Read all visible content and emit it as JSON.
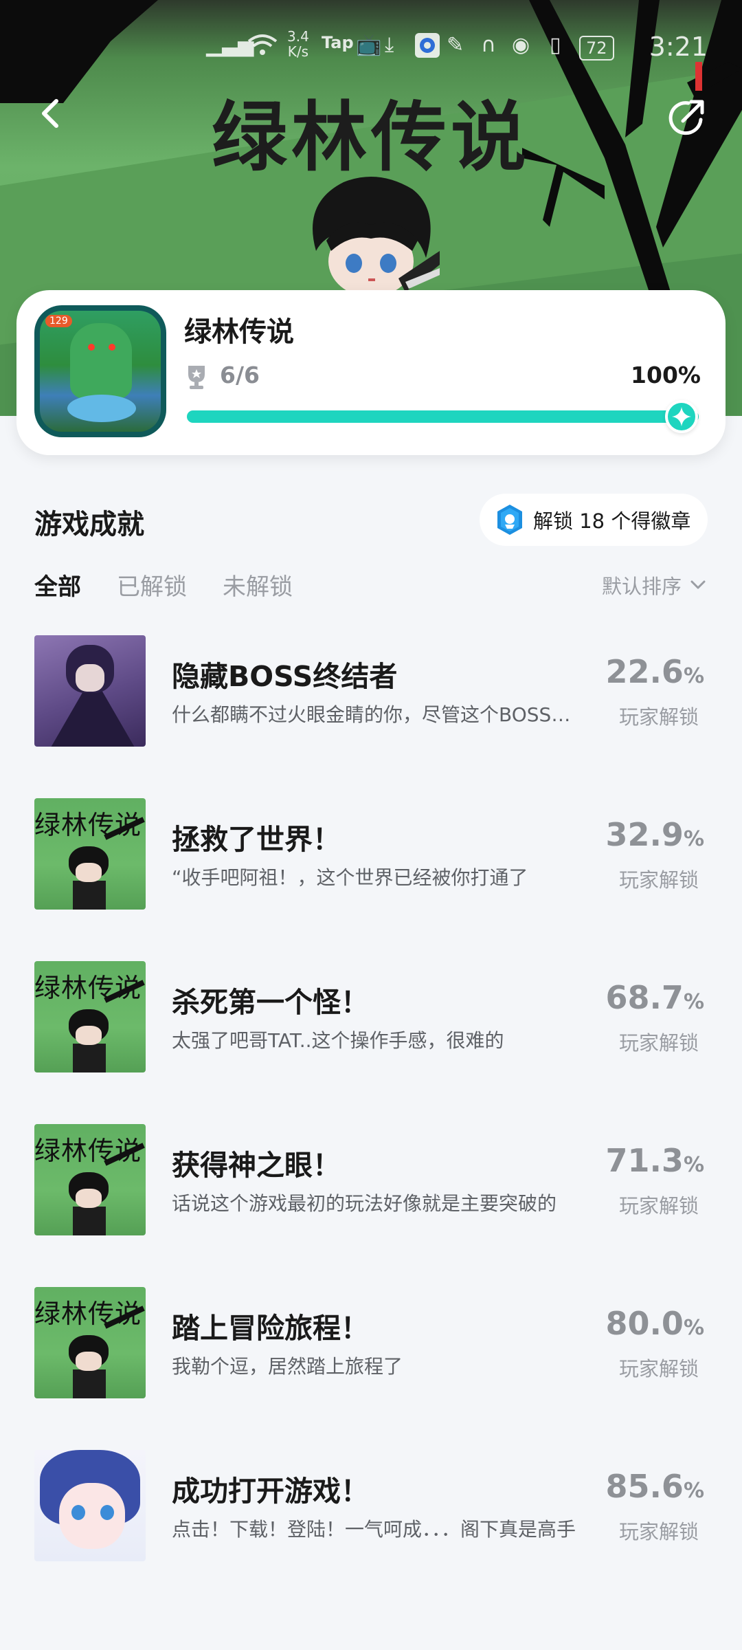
{
  "hero": {
    "title": "绿林传说"
  },
  "status_bar": {
    "net_speed_value": "3.4",
    "net_speed_unit": "K/s",
    "tap_label": "Tap",
    "battery": "72",
    "time": "3:21"
  },
  "game": {
    "name": "绿林传说",
    "icon_badge": "129",
    "progress_count": "6/6",
    "progress_percent": "100%",
    "progress_fraction": 1.0
  },
  "section": {
    "title": "游戏成就",
    "badge_label": "解锁 18 个得徽章"
  },
  "tabs": [
    {
      "label": "全部",
      "active": true
    },
    {
      "label": "已解锁",
      "active": false
    },
    {
      "label": "未解锁",
      "active": false
    }
  ],
  "sort": {
    "label": "默认排序"
  },
  "achievements": [
    {
      "name": "隐藏BOSS终结者",
      "desc": "什么都瞒不过火眼金睛的你，尽管这个BOSS藏得很深",
      "pct": "22.6",
      "unit": "%",
      "sub": "玩家解锁",
      "thumb": "purple"
    },
    {
      "name": "拯救了世界！",
      "desc": "“收手吧阿祖！，这个世界已经被你打通了",
      "pct": "32.9",
      "unit": "%",
      "sub": "玩家解锁",
      "thumb": "green",
      "thumb_text": "绿林传说"
    },
    {
      "name": "杀死第一个怪！",
      "desc": "太强了吧哥TAT..这个操作手感，很难的",
      "pct": "68.7",
      "unit": "%",
      "sub": "玩家解锁",
      "thumb": "green",
      "thumb_text": "绿林传说"
    },
    {
      "name": "获得神之眼！",
      "desc": "话说这个游戏最初的玩法好像就是主要突破的",
      "pct": "71.3",
      "unit": "%",
      "sub": "玩家解锁",
      "thumb": "green",
      "thumb_text": "绿林传说"
    },
    {
      "name": "踏上冒险旅程！",
      "desc": "我勒个逗，居然踏上旅程了",
      "pct": "80.0",
      "unit": "%",
      "sub": "玩家解锁",
      "thumb": "green",
      "thumb_text": "绿林传说"
    },
    {
      "name": "成功打开游戏！",
      "desc": "点击！下载！登陆！一气呵成．．．阁下真是高手",
      "pct": "85.6",
      "unit": "%",
      "sub": "玩家解锁",
      "thumb": "anime"
    }
  ],
  "colors": {
    "accent": "#1ed5bf",
    "background": "#f4f6f9",
    "muted": "#9a9da3"
  },
  "icons": [
    "back-arrow-icon",
    "share-icon",
    "trophy-icon",
    "badge-icon",
    "chevron-down-icon"
  ]
}
